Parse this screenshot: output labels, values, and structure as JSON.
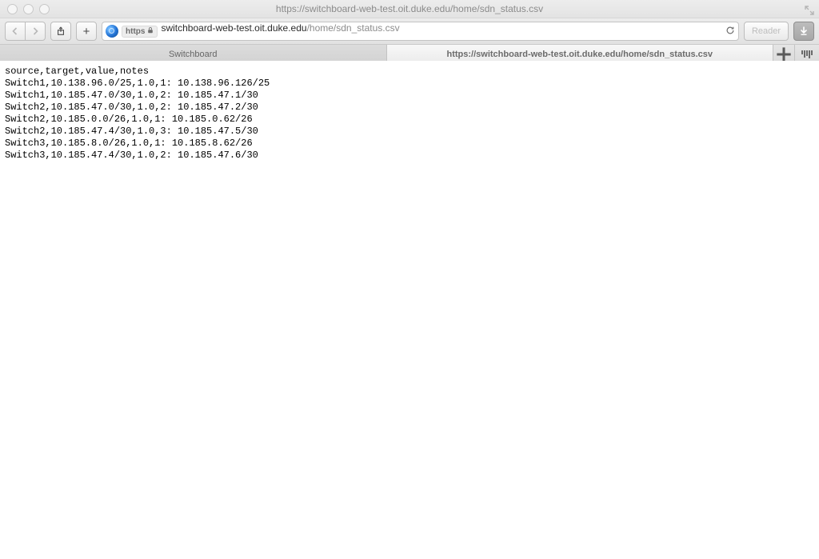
{
  "window": {
    "title": "https://switchboard-web-test.oit.duke.edu/home/sdn_status.csv"
  },
  "toolbar": {
    "url_scheme_label": "https",
    "url_host": "switchboard-web-test.oit.duke.edu",
    "url_path": "/home/sdn_status.csv",
    "reader_label": "Reader"
  },
  "tabs": [
    {
      "label": "Switchboard",
      "active": false
    },
    {
      "label": "https://switchboard-web-test.oit.duke.edu/home/sdn_status.csv",
      "active": true
    }
  ],
  "csv": {
    "lines": [
      "source,target,value,notes",
      "Switch1,10.138.96.0/25,1.0,1: 10.138.96.126/25",
      "Switch1,10.185.47.0/30,1.0,2: 10.185.47.1/30",
      "Switch2,10.185.47.0/30,1.0,2: 10.185.47.2/30",
      "Switch2,10.185.0.0/26,1.0,1: 10.185.0.62/26",
      "Switch2,10.185.47.4/30,1.0,3: 10.185.47.5/30",
      "Switch3,10.185.8.0/26,1.0,1: 10.185.8.62/26",
      "Switch3,10.185.47.4/30,1.0,2: 10.185.47.6/30"
    ]
  }
}
